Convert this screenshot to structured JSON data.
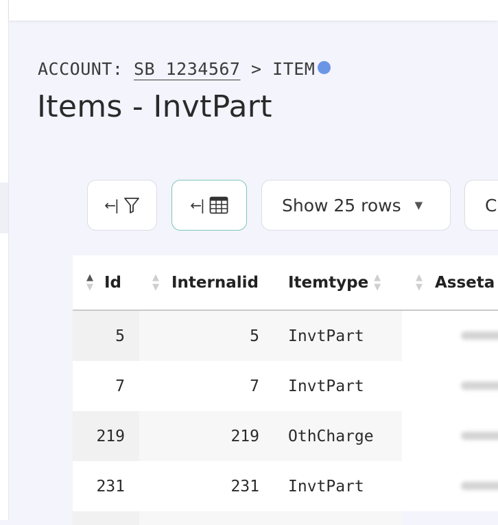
{
  "breadcrumb": {
    "prefix": "ACCOUNT: ",
    "account": "SB 1234567",
    "separator": " > ",
    "section": "ITEM"
  },
  "page": {
    "title": "Items - InvtPart"
  },
  "toolbar": {
    "filter_arrow": "←|",
    "columns_arrow": "←|",
    "rows_label": "Show 25 rows",
    "rows_caret": "▼",
    "partial_label": "C"
  },
  "table": {
    "columns": [
      "Id",
      "Internalid",
      "Itemtype",
      "Asseta"
    ],
    "rows": [
      {
        "id": "5",
        "internalid": "5",
        "itemtype": "InvtPart"
      },
      {
        "id": "7",
        "internalid": "7",
        "itemtype": "InvtPart"
      },
      {
        "id": "219",
        "internalid": "219",
        "itemtype": "OthCharge"
      },
      {
        "id": "231",
        "internalid": "231",
        "itemtype": "InvtPart"
      }
    ]
  },
  "colors": {
    "status_dot": "#6b96e6",
    "active_button_border": "#7cc7b6",
    "background": "#f3f4fc"
  },
  "icons": {
    "filter": "filter-icon",
    "columns": "table-grid-icon",
    "sort": "sort-arrows-icon"
  }
}
